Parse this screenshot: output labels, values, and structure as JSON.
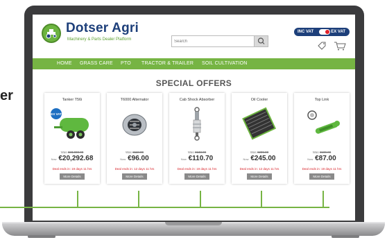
{
  "side_text": "er",
  "brand": {
    "name": "Dotser Agri",
    "tagline": "Machinery & Parts Dealer Platform",
    "logo_color": "#6cb43f",
    "brand_color": "#1d3f7a"
  },
  "search": {
    "placeholder": "Search"
  },
  "vat": {
    "inc_label": "INC VAT",
    "ex_label": "EX VAT"
  },
  "nav": {
    "items": [
      "HOME",
      "GRASS CARE",
      "PTO",
      "TRACTOR & TRAILER",
      "SOIL CULTIVATION"
    ],
    "color": "#76b443"
  },
  "offers": {
    "title": "SPECIAL OFFERS",
    "products": [
      {
        "name": "Tanker T56i",
        "was_label": "Was",
        "was": "€23,000.00",
        "now_label": "Now",
        "now": "€20,292.68",
        "deal": "Deal ends in: 19 days 11 hrs",
        "button": "More Details",
        "badge": "EX VAT",
        "icon": "slurry-tanker-icon"
      },
      {
        "name": "T6000 Alternator",
        "was_label": "Was",
        "was": "€118.00",
        "now_label": "Now",
        "now": "€96.00",
        "deal": "Deal ends in: 12 days 11 hrs",
        "button": "More Details",
        "icon": "alternator-icon"
      },
      {
        "name": "Cab Shock Absorber",
        "was_label": "Was",
        "was": "€133.00",
        "now_label": "Now",
        "now": "€110.70",
        "deal": "Deal ends in: 19 days 11 hrs",
        "button": "More Details",
        "icon": "shock-absorber-icon"
      },
      {
        "name": "Oil Cooler",
        "was_label": "Was",
        "was": "€299.00",
        "now_label": "Now",
        "now": "€245.00",
        "deal": "Deal ends in: 12 days 11 hrs",
        "button": "More Details",
        "icon": "oil-cooler-icon"
      },
      {
        "name": "Top Link",
        "was_label": "Was",
        "was": "€100.00",
        "now_label": "Now",
        "now": "€87.00",
        "deal": "Deal ends in: 19 days 11 hrs",
        "button": "More Details",
        "icon": "top-link-icon"
      }
    ]
  },
  "colors": {
    "accent_green": "#76b443",
    "deal_red": "#d8232a",
    "laptop_bezel": "#3b3b3d"
  }
}
